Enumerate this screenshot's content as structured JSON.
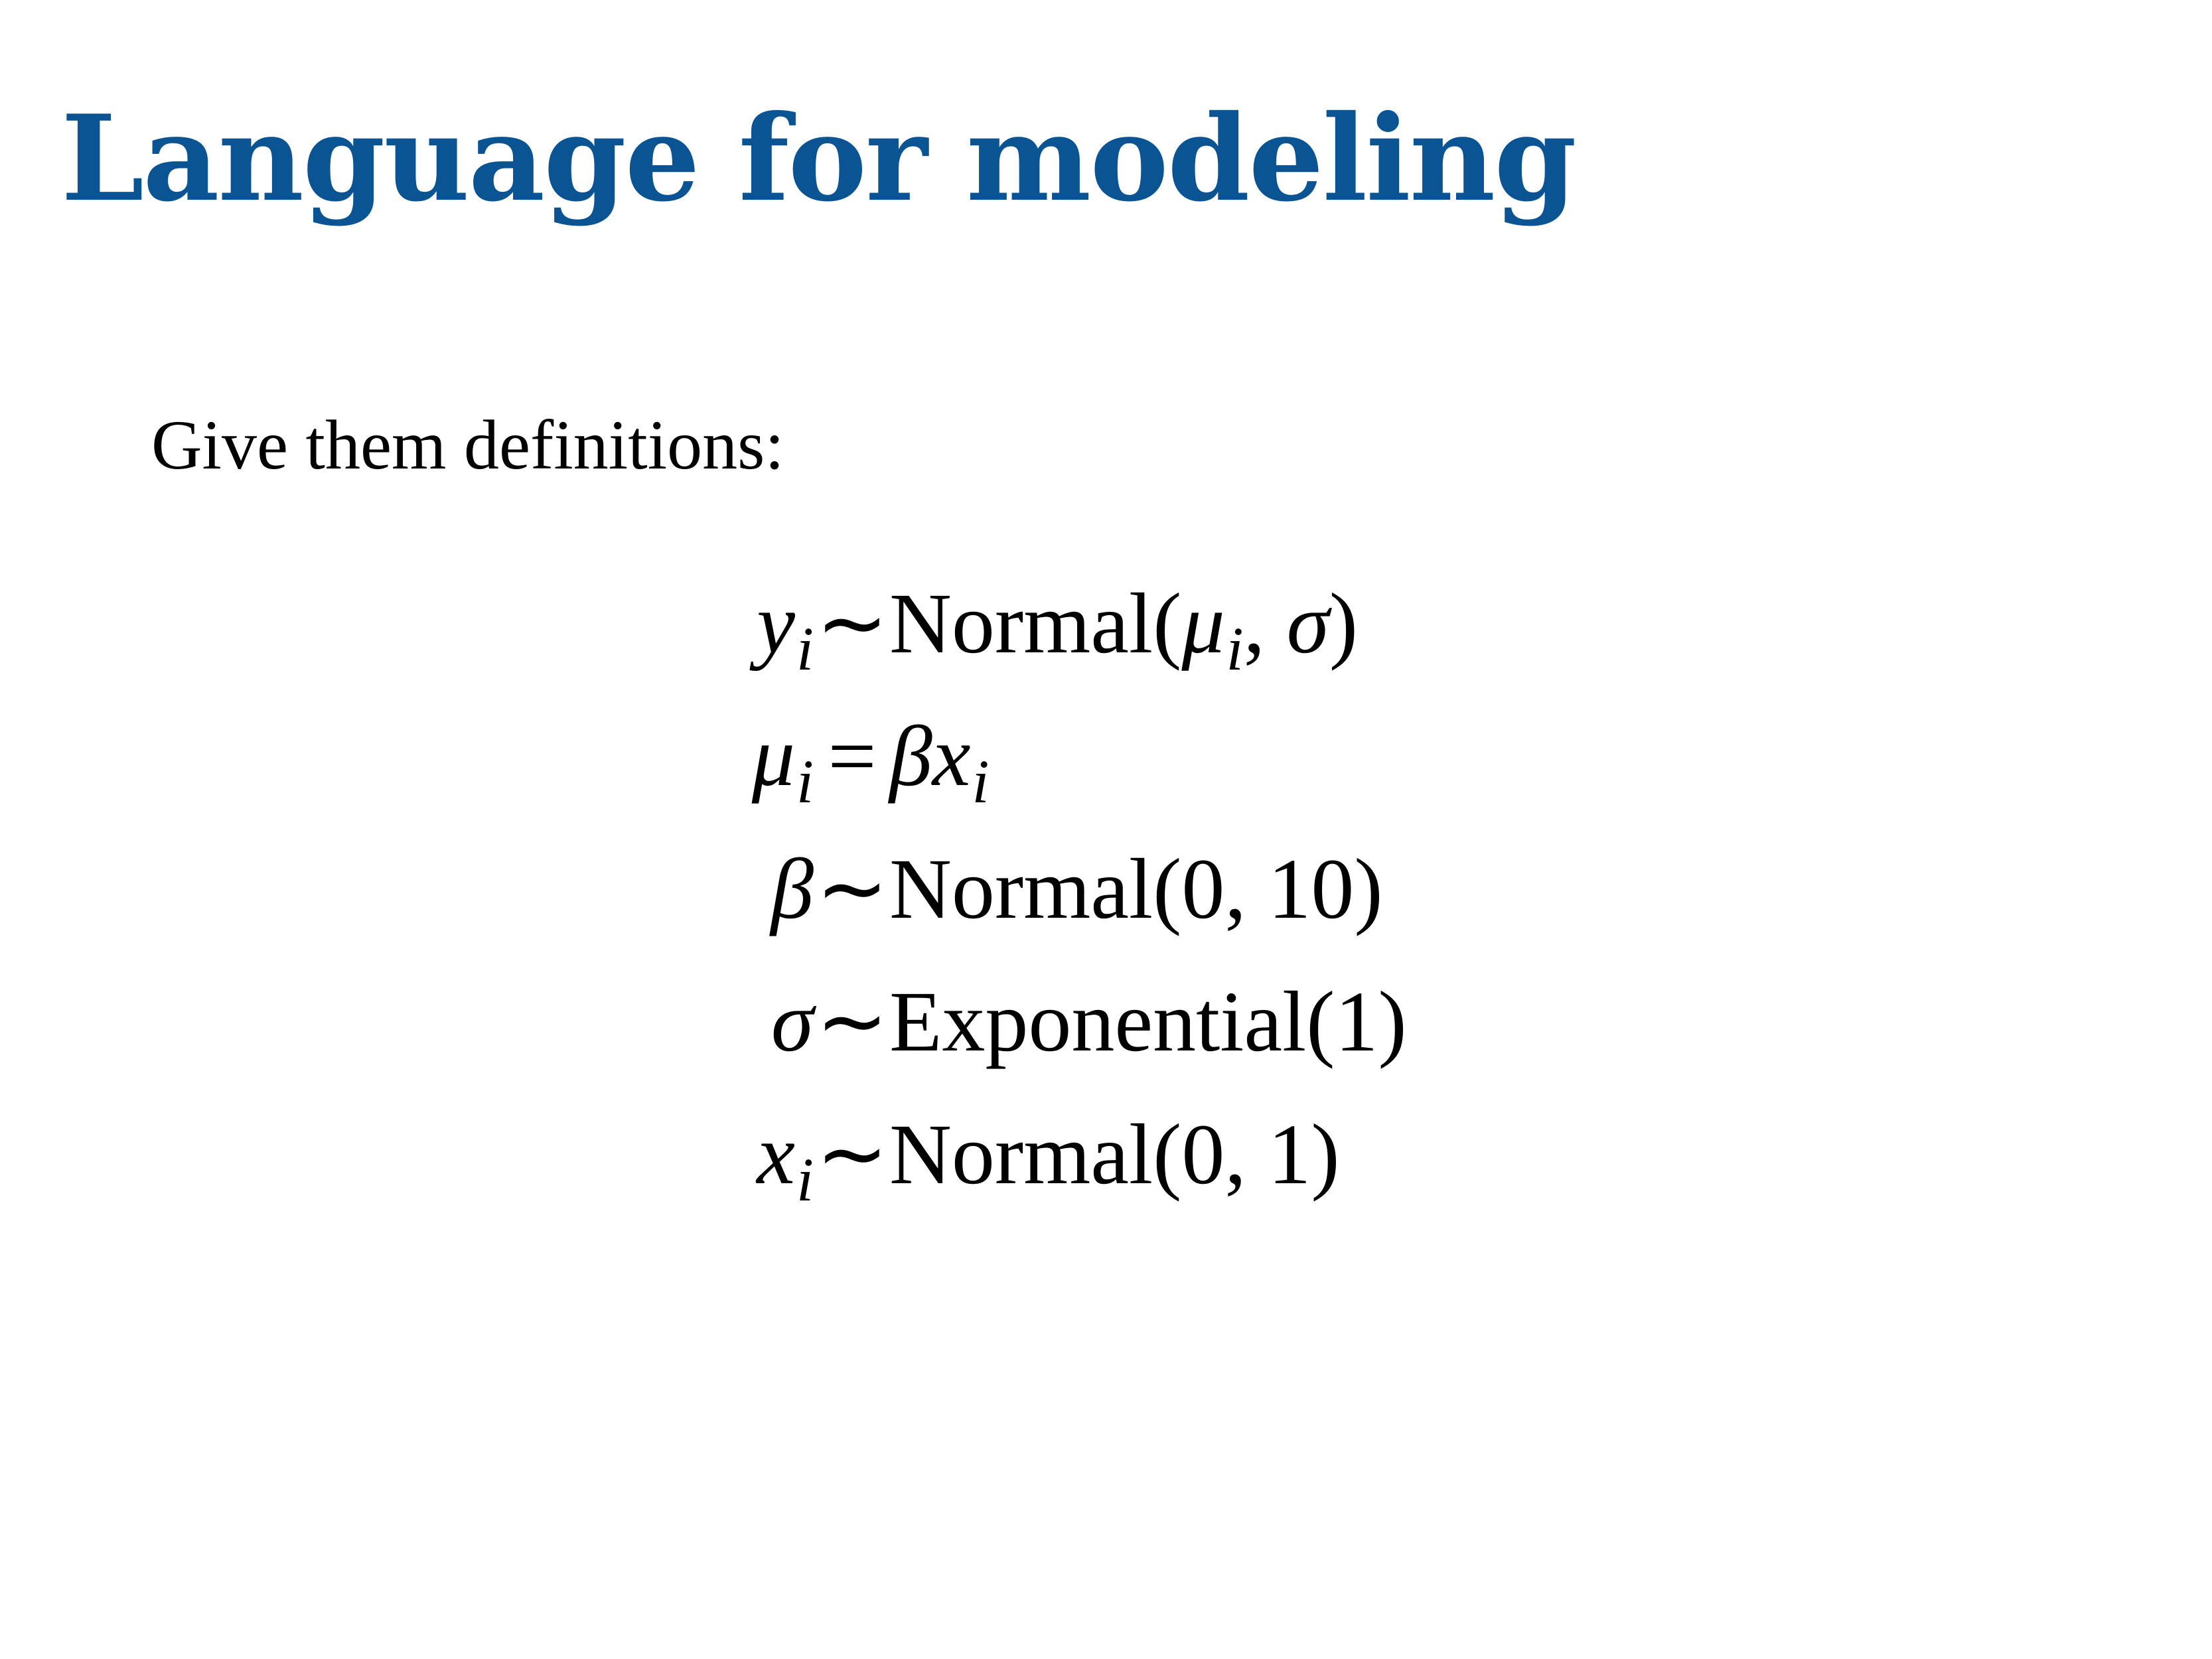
{
  "slide": {
    "title": "Language for modeling",
    "intro": "Give them definitions:",
    "accent_color": "#0b5494"
  },
  "equations": [
    {
      "lhs": {
        "symbol": "y",
        "subscript": "i"
      },
      "operator": "∼",
      "rhs": [
        {
          "kind": "text",
          "text": "Normal("
        },
        {
          "kind": "var",
          "symbol": "μ",
          "subscript": "i"
        },
        {
          "kind": "text",
          "text": ", "
        },
        {
          "kind": "var",
          "symbol": "σ"
        },
        {
          "kind": "text",
          "text": ")"
        }
      ]
    },
    {
      "lhs": {
        "symbol": "μ",
        "subscript": "i"
      },
      "operator": "=",
      "rhs": [
        {
          "kind": "var",
          "symbol": "β"
        },
        {
          "kind": "var",
          "symbol": "x",
          "subscript": "i"
        }
      ]
    },
    {
      "lhs": {
        "symbol": "β"
      },
      "operator": "∼",
      "rhs": [
        {
          "kind": "text",
          "text": "Normal(0, 10)"
        }
      ]
    },
    {
      "lhs": {
        "symbol": "σ"
      },
      "operator": "∼",
      "rhs": [
        {
          "kind": "text",
          "text": "Exponential(1)"
        }
      ]
    },
    {
      "lhs": {
        "symbol": "x",
        "subscript": "i"
      },
      "operator": "∼",
      "rhs": [
        {
          "kind": "text",
          "text": "Normal(0, 1)"
        }
      ]
    }
  ]
}
